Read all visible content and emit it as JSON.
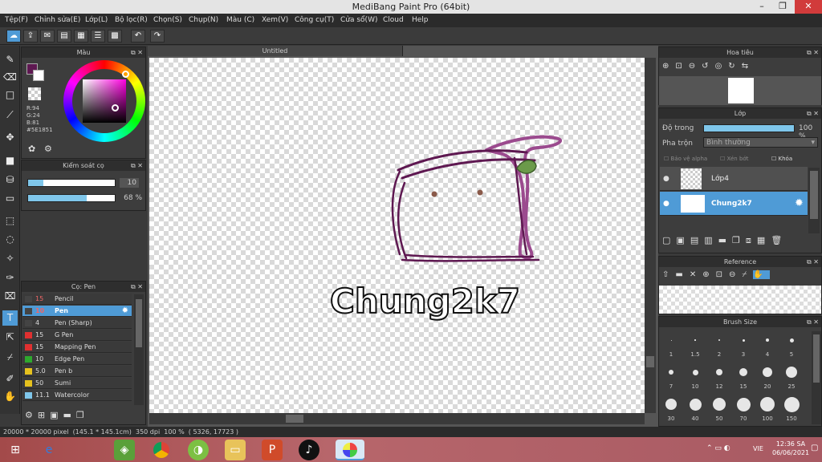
{
  "window": {
    "title": "MediBang Paint Pro (64bit)",
    "controls": [
      "–",
      "❐",
      "✕"
    ]
  },
  "menu": [
    "Tệp(F)",
    "Chỉnh sửa(E)",
    "Lớp(L)",
    "Bộ lọc(R)",
    "Chọn(S)",
    "Chụp(N)",
    "Màu (C)",
    "Xem(V)",
    "Công cụ(T)",
    "Cửa sổ(W)",
    "Cloud",
    "Help"
  ],
  "document": {
    "tab": "Untitled"
  },
  "color_panel": {
    "title": "Màu",
    "r": "R:94",
    "g": "G:24",
    "b": "B:81",
    "hex": "#5E1851",
    "primary": "#5E1851"
  },
  "brush_control": {
    "title": "Kiểm soát cọ",
    "size": "10",
    "opacity": "68 %"
  },
  "brush_list": {
    "title": "Cọ: Pen",
    "items": [
      {
        "size": "15",
        "name": "Pencil",
        "color": "#444444"
      },
      {
        "size": "10",
        "name": "Pen",
        "color": "#444444"
      },
      {
        "size": "4",
        "name": "Pen (Sharp)",
        "color": "#444444"
      },
      {
        "size": "15",
        "name": "G Pen",
        "color": "#e03030"
      },
      {
        "size": "15",
        "name": "Mapping Pen",
        "color": "#e03030"
      },
      {
        "size": "10",
        "name": "Edge Pen",
        "color": "#2ea82e"
      },
      {
        "size": "5.0",
        "name": "Pen b",
        "color": "#e6c21e"
      },
      {
        "size": "50",
        "name": "Sumi",
        "color": "#e6c21e"
      },
      {
        "size": "11.1",
        "name": "Watercolor",
        "color": "#7fc6ea"
      }
    ]
  },
  "navigator": {
    "title": "Hoa tiêu"
  },
  "layers_panel": {
    "title": "Lớp",
    "opacity_label": "Độ trong",
    "opacity_value": "100 %",
    "blend_label": "Pha trộn",
    "blend_value": "Bình thường",
    "protect_alpha": "Bảo vệ alpha",
    "clipping": "Xén bớt",
    "lock": "Khóa",
    "layers": [
      {
        "name": "Lớp4"
      },
      {
        "name": "Chung2k7"
      }
    ]
  },
  "reference_panel": {
    "title": "Reference"
  },
  "brush_size_panel": {
    "title": "Brush Size",
    "sizes": [
      "1",
      "1.5",
      "2",
      "3",
      "4",
      "5",
      "7",
      "10",
      "12",
      "15",
      "20",
      "25",
      "30",
      "40",
      "50",
      "70",
      "100",
      "150"
    ]
  },
  "canvas_art": {
    "text": "Chung2k7",
    "stroke_color": "#5E1851",
    "accent_color": "#9b4a8e",
    "leaf_color": "#6b9a4a"
  },
  "status": {
    "dimensions": "20000 * 20000 pixel",
    "size_cm": "(145.1 * 145.1cm)",
    "dpi": "350 dpi",
    "zoom": "100 %",
    "coords": "( 5326, 17723 )"
  },
  "taskbar": {
    "language": "VIE",
    "time": "12:36 SA",
    "date": "06/06/2021"
  }
}
